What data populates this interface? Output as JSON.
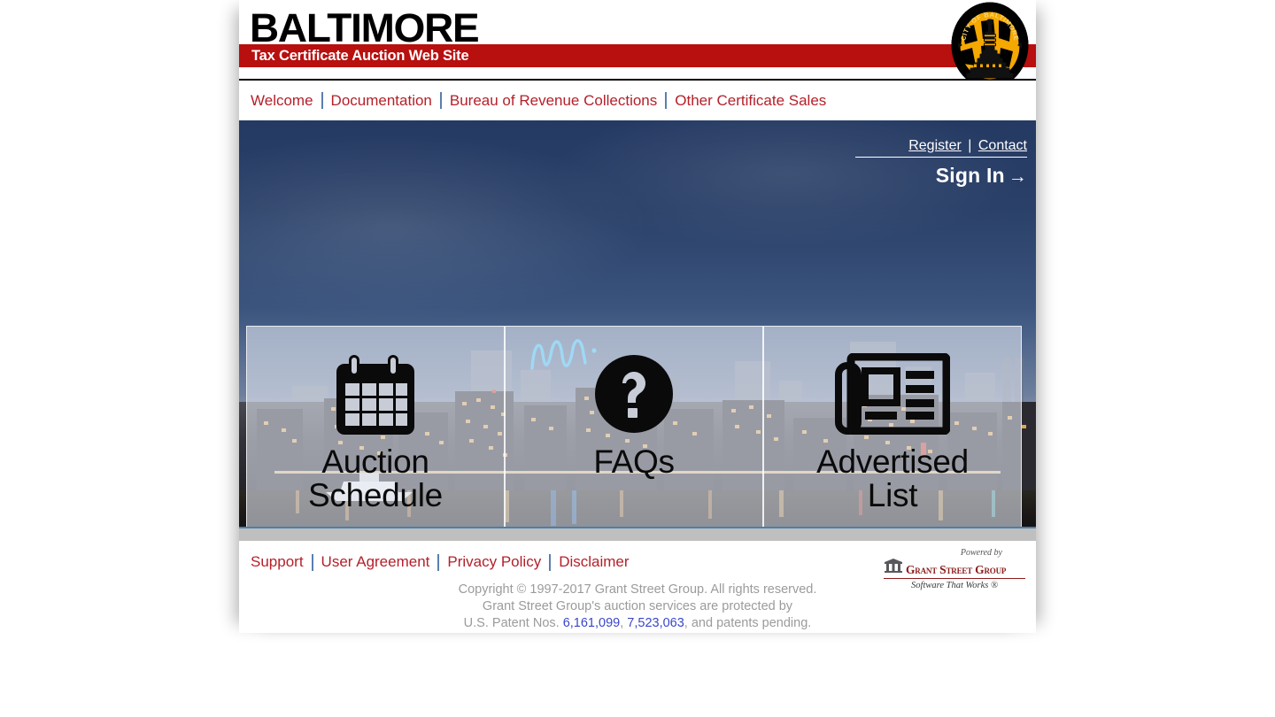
{
  "site": {
    "brand_title": "BALTIMORE",
    "brand_subtitle": "Tax Certificate Auction Web Site",
    "seal_text": "CITY OF BALTIMORE",
    "seal_icon": "city-seal-icon"
  },
  "nav": {
    "items": [
      {
        "label": "Welcome"
      },
      {
        "label": "Documentation"
      },
      {
        "label": "Bureau of Revenue Collections"
      },
      {
        "label": "Other Certificate Sales"
      }
    ]
  },
  "account": {
    "register_label": "Register",
    "separator": "|",
    "contact_label": "Contact",
    "signin_label": "Sign In",
    "signin_arrow": "→"
  },
  "tiles": [
    {
      "label_line1": "Auction",
      "label_line2": "Schedule",
      "icon": "calendar-icon"
    },
    {
      "label_line1": "FAQs",
      "label_line2": "",
      "icon": "question-mark-circle-icon"
    },
    {
      "label_line1": "Advertised",
      "label_line2": "List",
      "icon": "newspaper-icon"
    }
  ],
  "footer": {
    "links": [
      {
        "label": "Support"
      },
      {
        "label": "User Agreement"
      },
      {
        "label": "Privacy Policy"
      },
      {
        "label": "Disclaimer"
      }
    ],
    "logo": {
      "powered_by": "Powered by",
      "company": "Grant Street Group",
      "tagline": "Software That Works ®",
      "icon": "building-columns-icon"
    },
    "copyright_line1": "Copyright © 1997-2017 Grant Street Group. All rights reserved.",
    "copyright_line2": "Grant Street Group's auction services are protected by",
    "patent_prefix": "U.S. Patent Nos. ",
    "patent_1": "6,161,099",
    "patent_comma": ", ",
    "patent_2": "7,523,063",
    "patent_suffix": ", and patents pending."
  },
  "colors": {
    "brand_red": "#b80f0f",
    "link_red": "#b5202a",
    "separator_blue": "#5a7fae",
    "hero_navy": "#253a63",
    "patent_link_blue": "#3a46c8",
    "gray_strip": "#bfbfbf"
  }
}
